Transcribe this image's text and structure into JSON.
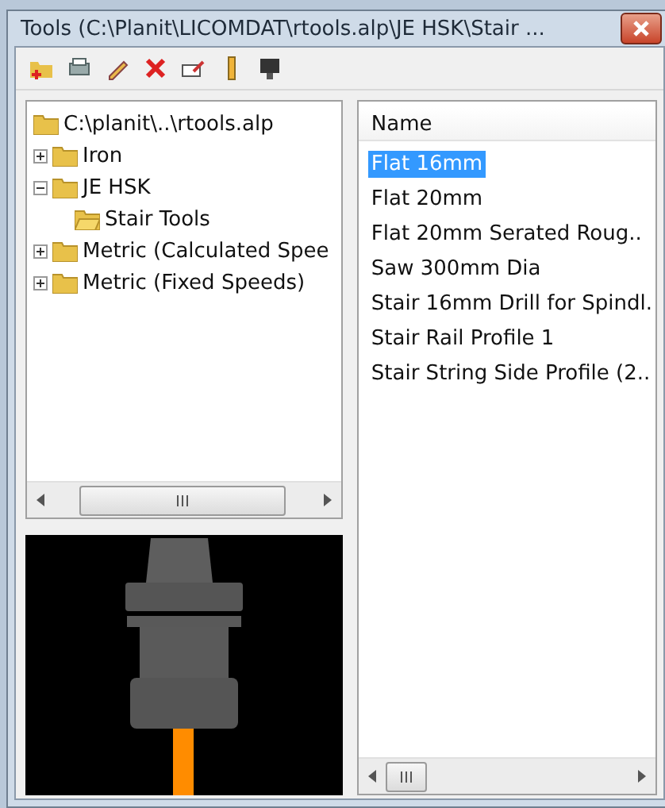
{
  "window": {
    "title": "Tools (C:\\Planit\\LICOMDAT\\rtools.alp\\JE HSK\\Stair ..."
  },
  "toolbar": [
    {
      "kind": "new-folder"
    },
    {
      "kind": "copy"
    },
    {
      "kind": "pencil"
    },
    {
      "kind": "delete"
    },
    {
      "kind": "rename"
    },
    {
      "kind": "ruler"
    },
    {
      "kind": "tool"
    }
  ],
  "tree": {
    "items": [
      {
        "label": "C:\\planit\\..\\rtools.alp",
        "selected": false,
        "children": [
          {
            "label": "Iron",
            "expanded": false,
            "selected": false
          },
          {
            "label": "JE HSK",
            "expanded": true,
            "selected": false,
            "children": [
              {
                "label": "Stair Tools",
                "selected": true
              }
            ]
          },
          {
            "label": "Metric (Calculated Spee",
            "expanded": false,
            "selected": false
          },
          {
            "label": "Metric (Fixed Speeds)",
            "expanded": false,
            "selected": false
          }
        ]
      }
    ]
  },
  "list": {
    "columns": [
      "Name"
    ],
    "rows": [
      {
        "name": "Flat 16mm",
        "selected": true
      },
      {
        "name": "Flat 20mm",
        "selected": false
      },
      {
        "name": "Flat 20mm Serated Roug..",
        "selected": false
      },
      {
        "name": "Saw 300mm Dia",
        "selected": false
      },
      {
        "name": "Stair 16mm Drill for Spindl.",
        "selected": false
      },
      {
        "name": "Stair Rail Profile 1",
        "selected": false
      },
      {
        "name": "Stair String Side Profile (2..",
        "selected": false
      }
    ]
  }
}
